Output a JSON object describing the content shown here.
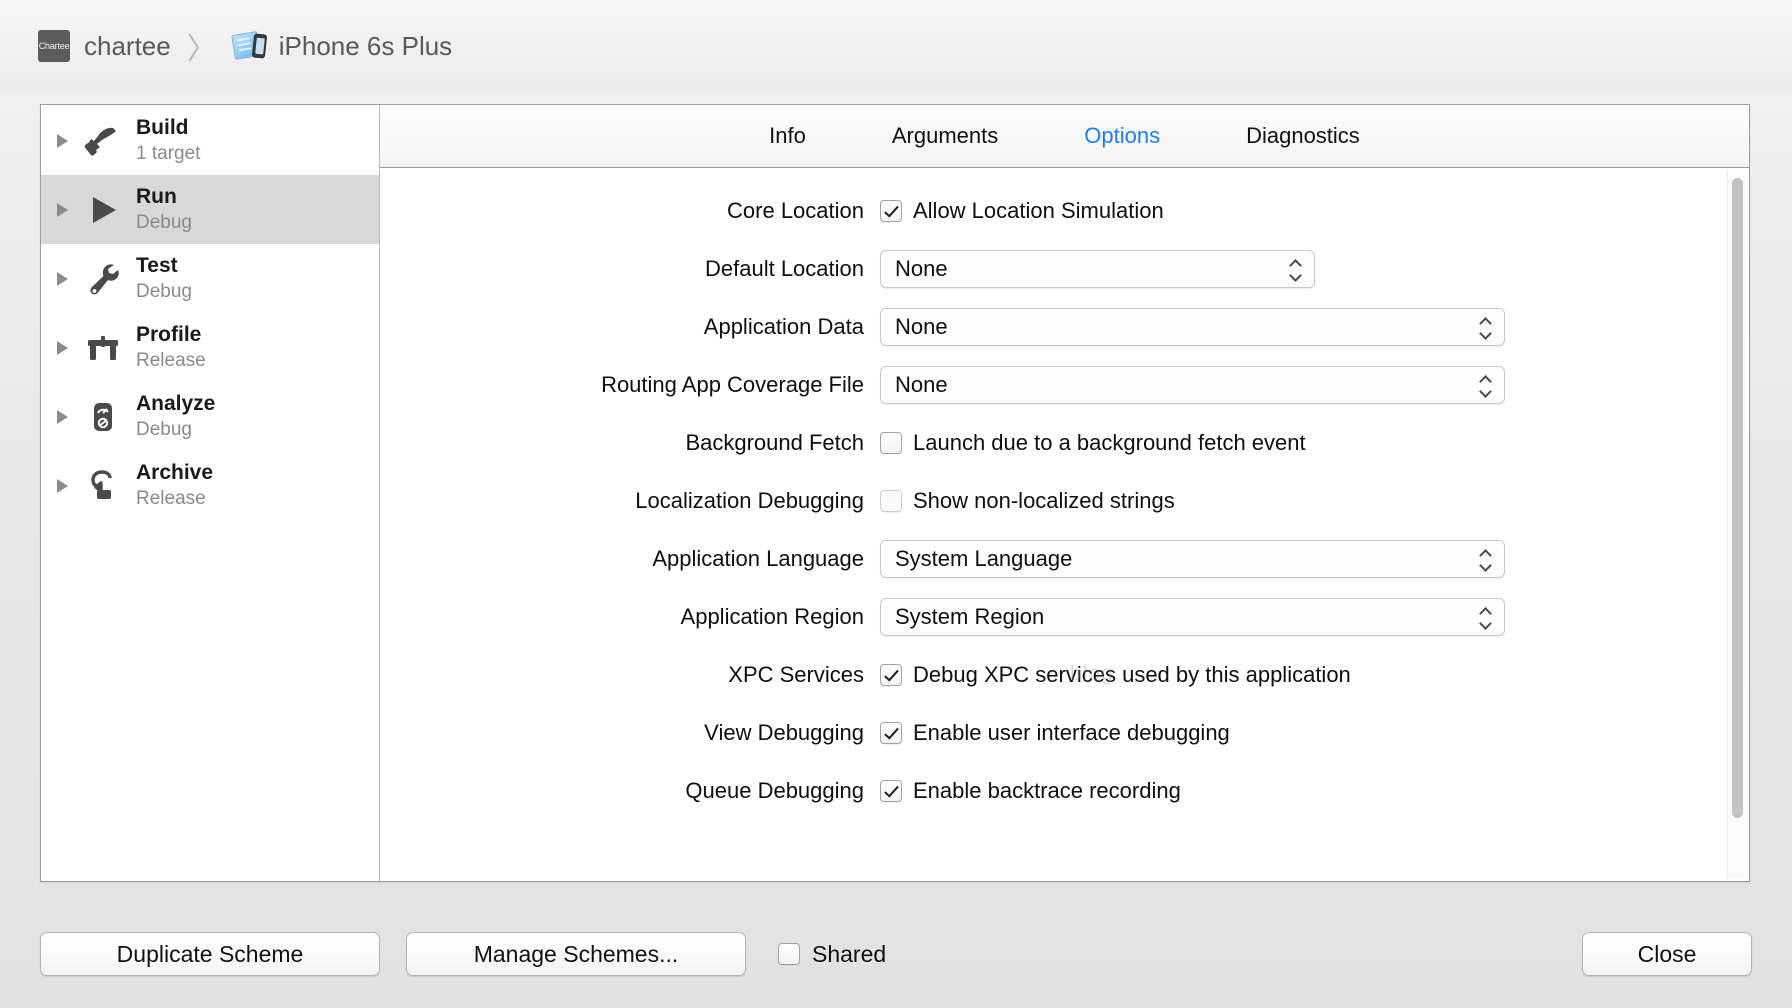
{
  "titlebar": {
    "app_badge_text": "Chartee",
    "project_name": "chartee",
    "separator": "〉",
    "destination": "iPhone 6s Plus"
  },
  "sidebar": {
    "items": [
      {
        "title": "Build",
        "subtitle": "1 target",
        "icon": "hammer-icon",
        "selected": false
      },
      {
        "title": "Run",
        "subtitle": "Debug",
        "icon": "play-icon",
        "selected": true
      },
      {
        "title": "Test",
        "subtitle": "Debug",
        "icon": "wrench-icon",
        "selected": false
      },
      {
        "title": "Profile",
        "subtitle": "Release",
        "icon": "caliper-icon",
        "selected": false
      },
      {
        "title": "Analyze",
        "subtitle": "Debug",
        "icon": "gauge-icon",
        "selected": false
      },
      {
        "title": "Archive",
        "subtitle": "Release",
        "icon": "archive-icon",
        "selected": false
      }
    ]
  },
  "tabs": {
    "items": [
      {
        "label": "Info",
        "active": false
      },
      {
        "label": "Arguments",
        "active": false
      },
      {
        "label": "Options",
        "active": true
      },
      {
        "label": "Diagnostics",
        "active": false
      }
    ],
    "active_color": "#1b7ef7"
  },
  "options": {
    "core_location": {
      "label": "Core Location",
      "checkbox_label": "Allow Location Simulation",
      "checked": true
    },
    "default_location": {
      "label": "Default Location",
      "value": "None"
    },
    "application_data": {
      "label": "Application Data",
      "value": "None"
    },
    "routing_app_coverage": {
      "label": "Routing App Coverage File",
      "value": "None"
    },
    "background_fetch": {
      "label": "Background Fetch",
      "checkbox_label": "Launch due to a background fetch event",
      "checked": false
    },
    "localization_debugging": {
      "label": "Localization Debugging",
      "checkbox_label": "Show non-localized strings",
      "checked": false
    },
    "application_language": {
      "label": "Application Language",
      "value": "System Language"
    },
    "application_region": {
      "label": "Application Region",
      "value": "System Region"
    },
    "xpc_services": {
      "label": "XPC Services",
      "checkbox_label": "Debug XPC services used by this application",
      "checked": true
    },
    "view_debugging": {
      "label": "View Debugging",
      "checkbox_label": "Enable user interface debugging",
      "checked": true
    },
    "queue_debugging": {
      "label": "Queue Debugging",
      "checkbox_label": "Enable backtrace recording",
      "checked": true
    },
    "watermark": "blog."
  },
  "bottombar": {
    "duplicate_scheme": "Duplicate Scheme",
    "manage_schemes": "Manage Schemes...",
    "shared_label": "Shared",
    "shared_checked": false,
    "close": "Close"
  }
}
